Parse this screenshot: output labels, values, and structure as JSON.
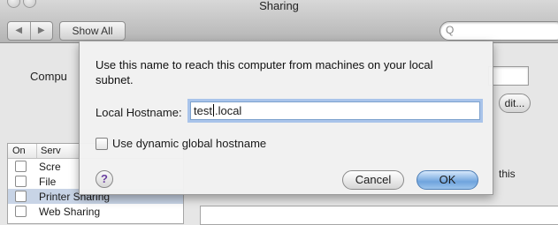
{
  "window": {
    "title": "Sharing"
  },
  "toolbar": {
    "back_icon": "◀",
    "forward_icon": "▶",
    "show_all_label": "Show All",
    "search_placeholder": "",
    "search_icon": "Q"
  },
  "background": {
    "computer_name_label": "Compu",
    "edit_button_label": "dit...",
    "service_list": {
      "headers": [
        "On",
        "Serv"
      ],
      "rows": [
        {
          "label": "Scre",
          "checked": false
        },
        {
          "label": "File",
          "checked": false
        },
        {
          "label": "Printer Sharing",
          "checked": false,
          "selected": true
        },
        {
          "label": "Web Sharing",
          "checked": false
        }
      ]
    },
    "right_text": "this"
  },
  "sheet": {
    "description": "Use this name to reach this computer from machines on your local subnet.",
    "hostname_label": "Local Hostname:",
    "hostname_value_before_caret": "test",
    "hostname_value_after_caret": ".local",
    "dynamic_checkbox_label": "Use dynamic global hostname",
    "dynamic_checked": false,
    "help_label": "?",
    "cancel_label": "Cancel",
    "ok_label": "OK"
  }
}
